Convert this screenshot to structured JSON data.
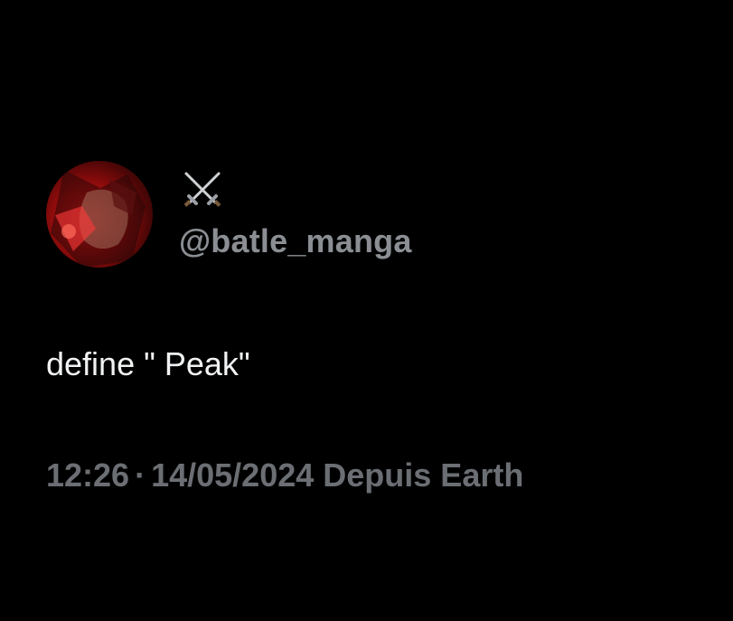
{
  "tweet": {
    "avatar": {
      "icon": "profile-avatar",
      "accent": "#e01c1c"
    },
    "display_name_icon": "crossed-swords-icon",
    "handle": "@batle_manga",
    "text": "define \" Peak\"",
    "meta": {
      "time": "12:26",
      "separator": "·",
      "date": "14/05/2024",
      "source": "Depuis Earth"
    }
  }
}
